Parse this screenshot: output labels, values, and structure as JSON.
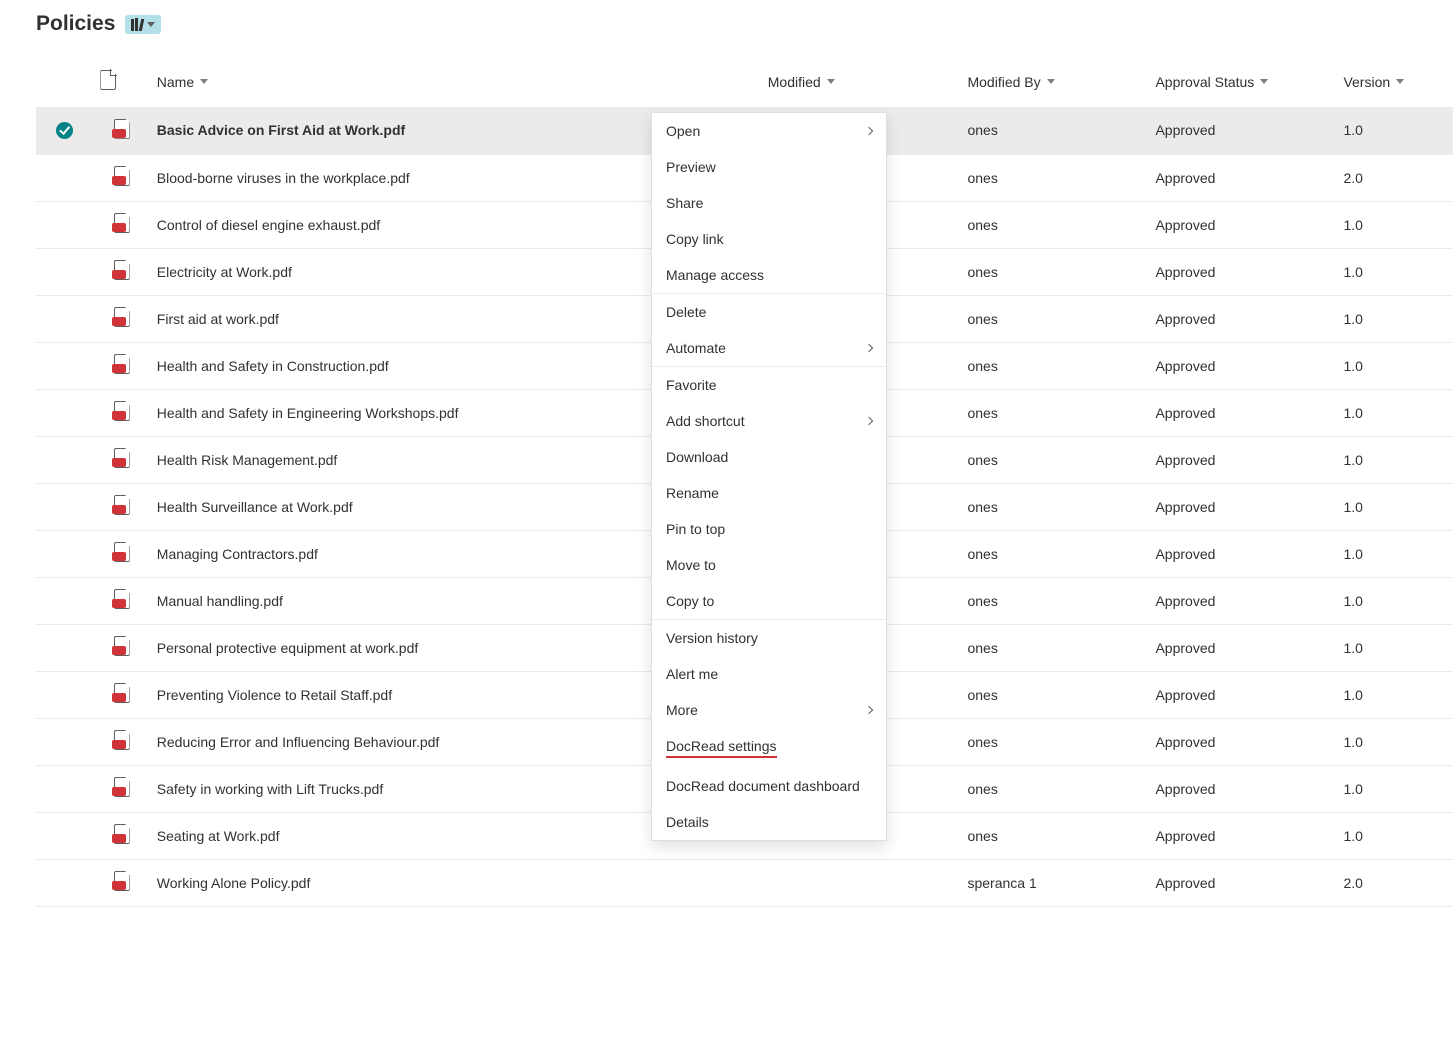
{
  "header": {
    "title": "Policies"
  },
  "columns": {
    "name": "Name",
    "modified": "Modified",
    "modifiedBy": "Modified By",
    "approval": "Approval Status",
    "version": "Version"
  },
  "rows": [
    {
      "name": "Basic Advice on First Aid at Work.pdf",
      "modifiedBy": "ones",
      "approval": "Approved",
      "version": "1.0",
      "selected": true
    },
    {
      "name": "Blood-borne viruses in the workplace.pdf",
      "modifiedBy": "ones",
      "approval": "Approved",
      "version": "2.0"
    },
    {
      "name": "Control of diesel engine exhaust.pdf",
      "modifiedBy": "ones",
      "approval": "Approved",
      "version": "1.0"
    },
    {
      "name": "Electricity at Work.pdf",
      "modifiedBy": "ones",
      "approval": "Approved",
      "version": "1.0"
    },
    {
      "name": "First aid at work.pdf",
      "modifiedBy": "ones",
      "approval": "Approved",
      "version": "1.0"
    },
    {
      "name": "Health and Safety in Construction.pdf",
      "modifiedBy": "ones",
      "approval": "Approved",
      "version": "1.0"
    },
    {
      "name": "Health and Safety in Engineering Workshops.pdf",
      "modifiedBy": "ones",
      "approval": "Approved",
      "version": "1.0"
    },
    {
      "name": "Health Risk Management.pdf",
      "modifiedBy": "ones",
      "approval": "Approved",
      "version": "1.0"
    },
    {
      "name": "Health Surveillance at Work.pdf",
      "modifiedBy": "ones",
      "approval": "Approved",
      "version": "1.0"
    },
    {
      "name": "Managing Contractors.pdf",
      "modifiedBy": "ones",
      "approval": "Approved",
      "version": "1.0"
    },
    {
      "name": "Manual handling.pdf",
      "modifiedBy": "ones",
      "approval": "Approved",
      "version": "1.0"
    },
    {
      "name": "Personal protective equipment at work.pdf",
      "modifiedBy": "ones",
      "approval": "Approved",
      "version": "1.0"
    },
    {
      "name": "Preventing Violence to Retail Staff.pdf",
      "modifiedBy": "ones",
      "approval": "Approved",
      "version": "1.0"
    },
    {
      "name": "Reducing Error and Influencing Behaviour.pdf",
      "modifiedBy": "ones",
      "approval": "Approved",
      "version": "1.0"
    },
    {
      "name": "Safety in working with Lift Trucks.pdf",
      "modifiedBy": "ones",
      "approval": "Approved",
      "version": "1.0"
    },
    {
      "name": "Seating at Work.pdf",
      "modifiedBy": "ones",
      "approval": "Approved",
      "version": "1.0"
    },
    {
      "name": "Working Alone Policy.pdf",
      "modifiedBy": "speranca 1",
      "approval": "Approved",
      "version": "2.0"
    }
  ],
  "menu": {
    "groups": [
      [
        {
          "label": "Open",
          "submenu": true
        },
        {
          "label": "Preview"
        },
        {
          "label": "Share"
        },
        {
          "label": "Copy link"
        },
        {
          "label": "Manage access"
        }
      ],
      [
        {
          "label": "Delete"
        },
        {
          "label": "Automate",
          "submenu": true
        }
      ],
      [
        {
          "label": "Favorite"
        },
        {
          "label": "Add shortcut",
          "submenu": true
        },
        {
          "label": "Download"
        },
        {
          "label": "Rename"
        },
        {
          "label": "Pin to top"
        },
        {
          "label": "Move to"
        },
        {
          "label": "Copy to"
        }
      ],
      [
        {
          "label": "Version history"
        },
        {
          "label": "Alert me"
        },
        {
          "label": "More",
          "submenu": true
        },
        {
          "label": "DocRead settings",
          "underlined": true
        },
        {
          "label": "DocRead document dashboard"
        },
        {
          "label": "Details"
        }
      ]
    ]
  }
}
